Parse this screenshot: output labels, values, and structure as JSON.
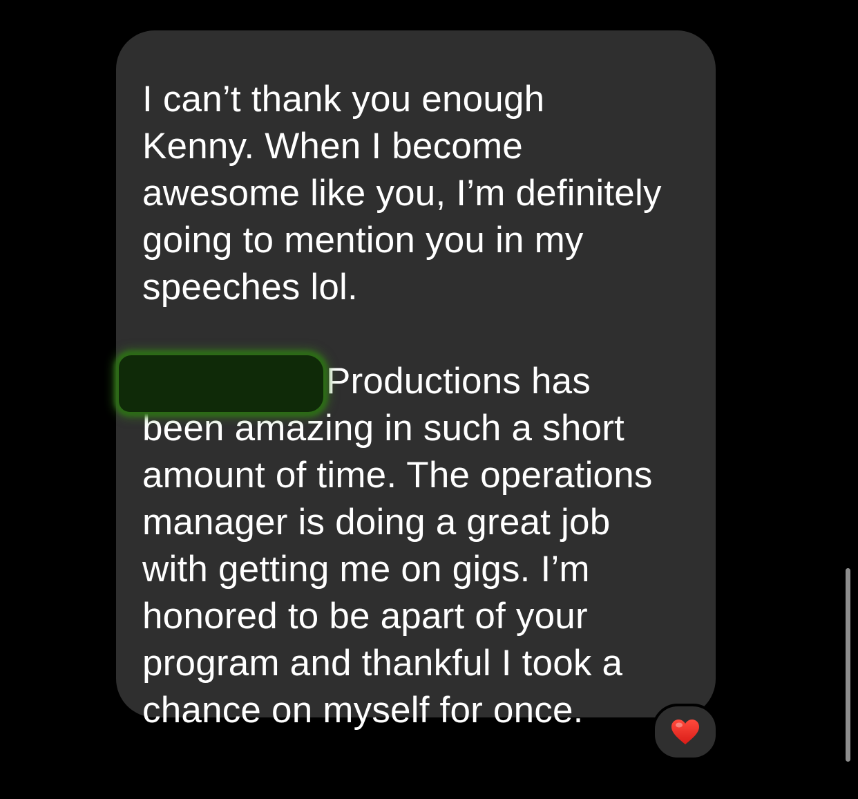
{
  "message": {
    "lines_para1": [
      "I can’t thank you enough",
      "Kenny. When I become",
      "awesome like you, I’m definitely",
      "going to mention you in my",
      "speeches lol."
    ],
    "para2_first_line_after_redaction": "Productions has",
    "lines_para2": [
      "been amazing in such a short",
      "amount of time. The operations",
      "manager is doing a great job",
      "with getting me on gigs. I’m",
      "honored to be apart of your",
      "program and thankful I took a",
      "chance on myself for once."
    ]
  },
  "reaction": {
    "icon": "heart-icon",
    "color": "#e0231f"
  },
  "colors": {
    "background": "#000000",
    "bubble": "#2f2f2f",
    "text": "#ffffff"
  }
}
